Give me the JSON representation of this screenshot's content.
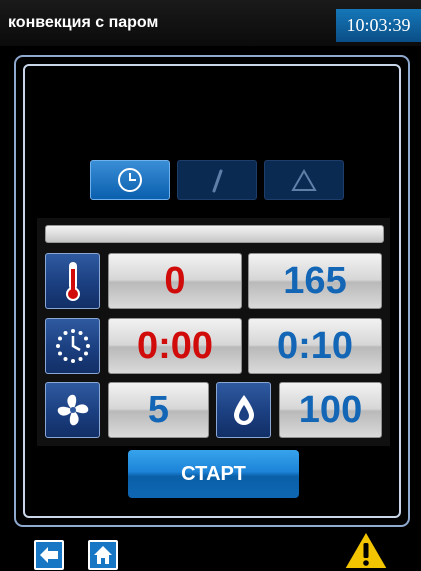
{
  "header": {
    "title": "конвекция с паром",
    "time": "10:03:39"
  },
  "mode_tabs": [
    {
      "icon": "clock-icon",
      "active": true
    },
    {
      "icon": "probe-icon",
      "active": false
    },
    {
      "icon": "triangle-icon",
      "active": false
    }
  ],
  "progress": 0,
  "rows": {
    "temperature": {
      "icon": "thermometer-icon",
      "actual": "0",
      "set": "165"
    },
    "time": {
      "icon": "timer-icon",
      "actual": "0:00",
      "set": "0:10"
    },
    "fan": {
      "icon": "fan-icon",
      "value": "5"
    },
    "humidity": {
      "icon": "water-drop-icon",
      "value": "100"
    }
  },
  "start_button": {
    "label": "СТАРТ"
  },
  "footer": {
    "back_icon": "arrow-left-icon",
    "home_icon": "home-icon",
    "warning_icon": "warning-icon"
  },
  "colors": {
    "accent": "#1577b8",
    "value_red": "#d10a0a",
    "value_blue": "#1366b5"
  }
}
